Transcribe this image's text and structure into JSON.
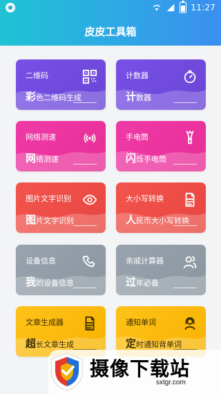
{
  "status": {
    "time": "11:27"
  },
  "header": {
    "title": "皮皮工具箱"
  },
  "colors": {
    "purple": "#6b46d6",
    "pink": "#e72e97",
    "red": "#e84640",
    "gray": "#8b96a0",
    "yellow": "#f7b300"
  },
  "cards": [
    {
      "label": "二维码",
      "sub_big": "彩",
      "sub_rest": "色二维码生成",
      "icon": "qr-code-icon"
    },
    {
      "label": "计数器",
      "sub_big": "计",
      "sub_rest": "数器",
      "icon": "timer-icon"
    },
    {
      "label": "网络测速",
      "sub_big": "网",
      "sub_rest": "络测速",
      "icon": "signal-broadcast-icon"
    },
    {
      "label": "手电筒",
      "sub_big": "闪",
      "sub_rest": "烁手电筒",
      "icon": "flashlight-icon"
    },
    {
      "label": "图片文字识别",
      "sub_big": "图",
      "sub_rest": "片文字识别",
      "icon": "eye-icon"
    },
    {
      "label": "大小写转换",
      "sub_big": "人",
      "sub_rest": "民币大小写转换",
      "icon": "document-icon"
    },
    {
      "label": "设备信息",
      "sub_big": "我",
      "sub_rest": "的设备信息",
      "icon": "phone-handset-icon"
    },
    {
      "label": "亲戚计算器",
      "sub_big": "过",
      "sub_rest": "年必备",
      "icon": "people-icon"
    },
    {
      "label": "文章生成器",
      "sub_big": "超",
      "sub_rest": "长文章生成",
      "icon": "document-lines-icon"
    },
    {
      "label": "通知单词",
      "sub_big": "定",
      "sub_rest": "时通知背单词",
      "icon": "headset-user-icon"
    }
  ],
  "watermark": {
    "text": "摄像下载站",
    "url": "sxtgr.com"
  }
}
